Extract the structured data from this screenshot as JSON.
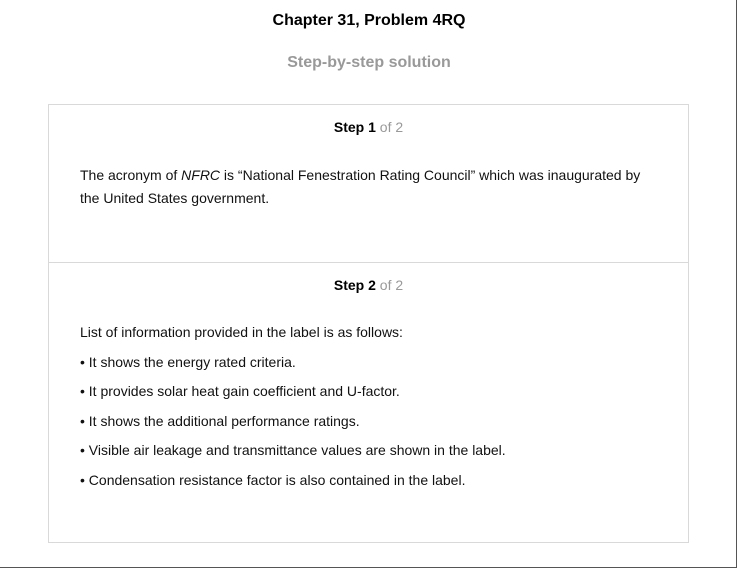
{
  "page": {
    "title": "Chapter 31, Problem 4RQ",
    "subtitle": "Step-by-step solution"
  },
  "steps": [
    {
      "word": "Step",
      "number": "1",
      "of": "of 2",
      "text_before": "The acronym of ",
      "text_em": "NFRC",
      "text_after": " is “National Fenestration Rating Council” which was inaugurated by the United States government."
    },
    {
      "word": "Step",
      "number": "2",
      "of": "of 2",
      "intro": "List of information provided in the label is as follows:",
      "bullets": [
        "• It shows the energy rated criteria.",
        "• It provides solar heat gain coefficient and U-factor.",
        "• It shows the additional performance ratings.",
        "• Visible air leakage and transmittance values are shown in the label.",
        "• Condensation resistance factor is also contained in the label."
      ]
    }
  ]
}
